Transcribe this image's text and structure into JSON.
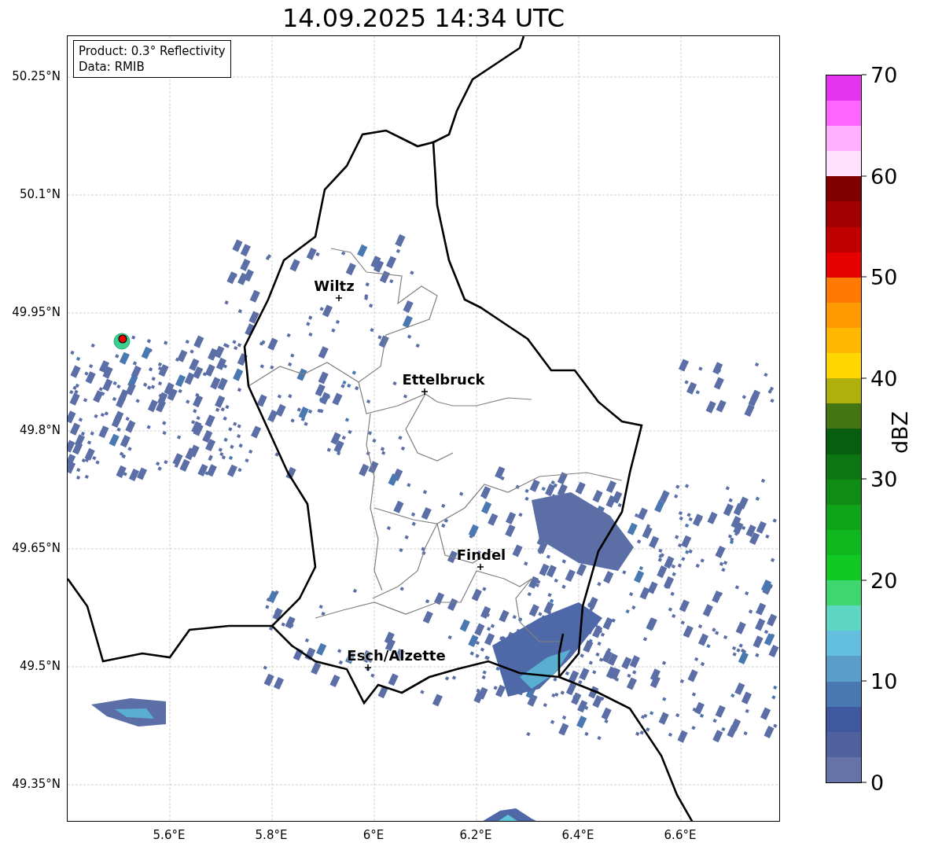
{
  "title": "14.09.2025 14:34 UTC",
  "info_box": [
    "Product: 0.3° Reflectivity",
    "Data: RMIB"
  ],
  "map": {
    "y_ticks": [
      "50.25°N",
      "50.1°N",
      "49.95°N",
      "49.8°N",
      "49.65°N",
      "49.5°N",
      "49.35°N"
    ],
    "x_ticks": [
      "5.6°E",
      "5.8°E",
      "6°E",
      "6.2°E",
      "6.4°E",
      "6.6°E"
    ],
    "cities": [
      {
        "name": "Wiltz"
      },
      {
        "name": "Ettelbruck"
      },
      {
        "name": "Findel"
      },
      {
        "name": "Esch/Alzette"
      }
    ]
  },
  "colorbar": {
    "label": "dBZ",
    "ticks": [
      "70",
      "60",
      "50",
      "40",
      "30",
      "20",
      "10",
      "0"
    ],
    "levels": [
      {
        "color": "#6673a6"
      },
      {
        "color": "#50629e"
      },
      {
        "color": "#3f58a0"
      },
      {
        "color": "#4a78b0"
      },
      {
        "color": "#5a9dc8"
      },
      {
        "color": "#64bee0"
      },
      {
        "color": "#5ed6c4"
      },
      {
        "color": "#3ed66e"
      },
      {
        "color": "#12c822"
      },
      {
        "color": "#10b820"
      },
      {
        "color": "#10a418"
      },
      {
        "color": "#0e8c14"
      },
      {
        "color": "#0b7612"
      },
      {
        "color": "#075e0e"
      },
      {
        "color": "#447510"
      },
      {
        "color": "#b0b00a"
      },
      {
        "color": "#ffd600"
      },
      {
        "color": "#ffb800"
      },
      {
        "color": "#ff9a00"
      },
      {
        "color": "#ff7a00"
      },
      {
        "color": "#e60000"
      },
      {
        "color": "#c00000"
      },
      {
        "color": "#a00000"
      },
      {
        "color": "#800000"
      },
      {
        "color": "#ffe0ff"
      },
      {
        "color": "#ffb0ff"
      },
      {
        "color": "#ff66ff"
      },
      {
        "color": "#e633ee"
      }
    ]
  }
}
